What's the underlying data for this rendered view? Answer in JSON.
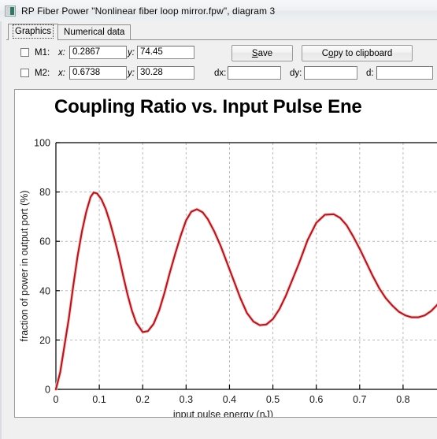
{
  "window": {
    "title": "RP Fiber Power \"Nonlinear fiber loop mirror.fpw\", diagram 3",
    "icon": "app-icon"
  },
  "tabs": [
    {
      "label": "Graphics",
      "active": true
    },
    {
      "label": "Numerical data",
      "active": false
    }
  ],
  "markers": {
    "m1": {
      "label": "M1:",
      "x_label": "x:",
      "x_value": "0.2867",
      "y_label": "y:",
      "y_value": "74.45",
      "checked": false
    },
    "m2": {
      "label": "M2:",
      "x_label": "x:",
      "x_value": "0.6738",
      "y_label": "y:",
      "y_value": "30.28",
      "checked": false
    }
  },
  "buttons": {
    "save": {
      "label": "Save",
      "accel": "S"
    },
    "copy": {
      "label": "Copy to clipboard",
      "accel": "o"
    }
  },
  "deltas": {
    "dx": {
      "label": "dx:",
      "value": ""
    },
    "dy": {
      "label": "dy:",
      "value": ""
    },
    "d": {
      "label": "d:",
      "value": ""
    }
  },
  "colors": {
    "curve": "#a81c22",
    "curve_glow": "#f6c9cb",
    "grid": "#b9b9b9",
    "axis": "#000000",
    "panel_bg": "#ffffff",
    "window_bg": "#f0f0f0"
  },
  "chart_data": {
    "type": "line",
    "title": "Coupling Ratio vs. Input Pulse Ene",
    "title_full": "Coupling Ratio vs. Input Pulse Energy",
    "title_clipped": true,
    "xlabel": "input pulse energy (nJ)",
    "ylabel": "fraction of power in output port (%)",
    "xlim": [
      0,
      0.88
    ],
    "ylim": [
      0,
      100
    ],
    "xticks": [
      0,
      0.1,
      0.2,
      0.3,
      0.4,
      0.5,
      0.6,
      0.7,
      0.8
    ],
    "xticklabels": [
      "0",
      "0.1",
      "0.2",
      "0.3",
      "0.4",
      "0.5",
      "0.6",
      "0.7",
      "0.8"
    ],
    "yticks": [
      0,
      20,
      40,
      60,
      80,
      100
    ],
    "yticklabels": [
      "0",
      "20",
      "40",
      "60",
      "80",
      "100"
    ],
    "grid": true,
    "grid_style": "dashed",
    "legend": null,
    "series": [
      {
        "name": "fraction of power in output port",
        "color": "#a81c22",
        "x": [
          0.0,
          0.01,
          0.02,
          0.03,
          0.04,
          0.05,
          0.06,
          0.07,
          0.08,
          0.087,
          0.095,
          0.105,
          0.115,
          0.125,
          0.135,
          0.145,
          0.155,
          0.165,
          0.175,
          0.185,
          0.2,
          0.212,
          0.225,
          0.238,
          0.25,
          0.262,
          0.275,
          0.288,
          0.3,
          0.312,
          0.325,
          0.338,
          0.35,
          0.365,
          0.38,
          0.395,
          0.41,
          0.425,
          0.44,
          0.455,
          0.47,
          0.485,
          0.5,
          0.515,
          0.53,
          0.545,
          0.56,
          0.58,
          0.6,
          0.62,
          0.64,
          0.655,
          0.67,
          0.685,
          0.7,
          0.715,
          0.73,
          0.745,
          0.76,
          0.775,
          0.79,
          0.805,
          0.82,
          0.835,
          0.85,
          0.865,
          0.88
        ],
        "y": [
          0.0,
          7.0,
          18.0,
          29.0,
          42.0,
          54.0,
          64.0,
          72.0,
          78.0,
          79.8,
          79.4,
          77.0,
          73.0,
          67.5,
          61.0,
          54.0,
          46.0,
          38.5,
          32.0,
          27.0,
          23.2,
          23.6,
          26.5,
          32.0,
          39.0,
          47.0,
          55.0,
          62.5,
          68.5,
          72.0,
          73.0,
          71.8,
          69.0,
          64.0,
          58.0,
          51.0,
          44.0,
          37.0,
          31.0,
          27.5,
          26.0,
          26.3,
          28.5,
          32.5,
          38.0,
          44.5,
          51.0,
          60.5,
          67.5,
          70.8,
          71.0,
          69.5,
          66.5,
          62.0,
          57.0,
          51.5,
          46.0,
          41.0,
          37.0,
          34.0,
          31.5,
          30.0,
          29.2,
          29.2,
          30.0,
          31.8,
          34.5
        ],
        "peaks": [
          {
            "x": 0.087,
            "y": 79.8
          },
          {
            "x": 0.325,
            "y": 73.0
          },
          {
            "x": 0.605,
            "y": 71.0
          }
        ],
        "minima": [
          {
            "x": 0.2,
            "y": 23.2
          },
          {
            "x": 0.47,
            "y": 26.0
          },
          {
            "x": 0.82,
            "y": 29.2
          }
        ]
      }
    ]
  }
}
